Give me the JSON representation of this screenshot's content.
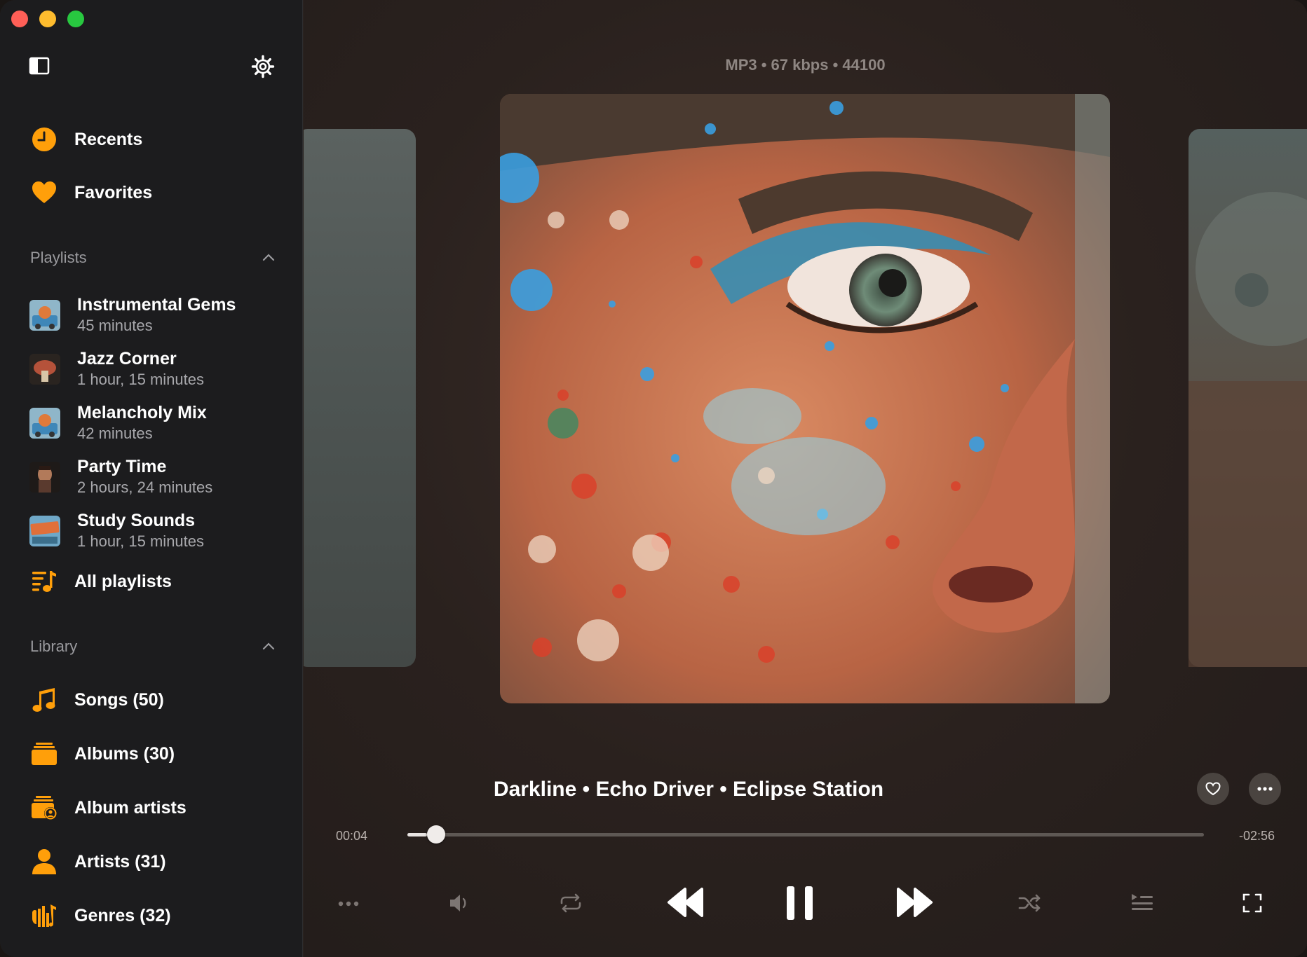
{
  "window": {
    "traffic_lights": [
      "close",
      "minimize",
      "zoom"
    ]
  },
  "sidebar": {
    "nav": [
      {
        "label": "Recents",
        "icon": "clock-icon"
      },
      {
        "label": "Favorites",
        "icon": "heart-icon"
      }
    ],
    "playlists_header": "Playlists",
    "playlists": [
      {
        "title": "Instrumental Gems",
        "duration": "45 minutes"
      },
      {
        "title": "Jazz Corner",
        "duration": "1 hour, 15 minutes"
      },
      {
        "title": "Melancholy Mix",
        "duration": "42 minutes"
      },
      {
        "title": "Party Time",
        "duration": "2 hours, 24 minutes"
      },
      {
        "title": "Study Sounds",
        "duration": "1 hour, 15 minutes"
      }
    ],
    "all_playlists": "All playlists",
    "library_header": "Library",
    "library": [
      {
        "label": "Songs (50)",
        "icon": "music-note-icon"
      },
      {
        "label": "Albums (30)",
        "icon": "album-stack-icon"
      },
      {
        "label": "Album artists",
        "icon": "album-artist-icon"
      },
      {
        "label": "Artists (31)",
        "icon": "person-icon"
      },
      {
        "label": "Genres (32)",
        "icon": "genres-icon"
      }
    ]
  },
  "player": {
    "format_info": "MP3 • 67 kbps • 44100",
    "track_line": "Darkline • Echo Driver • Eclipse Station",
    "elapsed": "00:04",
    "remaining": "-02:56",
    "progress": 0.025
  },
  "colors": {
    "accent": "#ff9f0a",
    "sidebar_bg": "#1c1c1e",
    "main_bg": "#2a211e"
  }
}
